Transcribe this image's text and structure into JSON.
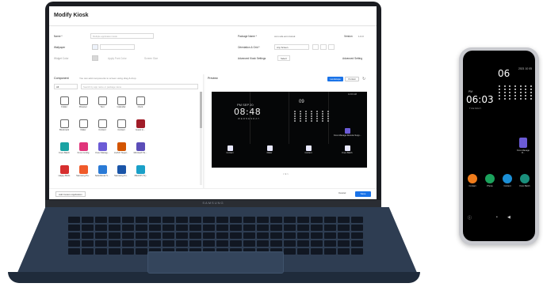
{
  "app": {
    "title": "Modify Kiosk",
    "fields": {
      "name_label": "Name *",
      "name_placeholder": "Multiple application kiosk",
      "package_label": "Package Name *",
      "package_value": "com.sds.emm.kiosk",
      "version_label": "Version",
      "version_value": "1.0.0",
      "wallpaper_label": "Wallpaper",
      "orientation_label": "Orientation & Grid *",
      "orientation_value": "Any Screen",
      "widget_label": "Widget Color",
      "apply_font_label": "Apply Font Color",
      "screen_size_label": "Screen Size",
      "kiosk_settings_label": "Advanced Kiosk Settings",
      "kiosk_settings_button": "Select",
      "advanced_setting": "Advanced Setting"
    },
    "components": {
      "title": "Component",
      "description": "You can add components to screen using drag & drop.",
      "filter": "All",
      "search_placeholder": "Search by app name or package name",
      "tiles": [
        {
          "label": "Folder",
          "icon": "folder-icon"
        },
        {
          "label": "Browser",
          "icon": "browser-icon"
        },
        {
          "label": "Text",
          "icon": "text-icon"
        },
        {
          "label": "Calendar",
          "icon": "calendar-icon"
        },
        {
          "label": "Clock",
          "icon": "clock-icon"
        },
        {
          "label": "Bookmark",
          "icon": "bookmark-icon"
        },
        {
          "label": "Dialer",
          "icon": "phone-icon"
        },
        {
          "label": "Content",
          "icon": "content-icon"
        },
        {
          "label": "Contact",
          "icon": "contact-icon"
        },
        {
          "label": "Guest lo...",
          "icon": "guest-icon"
        },
        {
          "label": "Knox Batch",
          "icon": "app-icon"
        },
        {
          "label": "Knox Config",
          "icon": "app-icon"
        },
        {
          "label": "Knox Manag...",
          "icon": "app-icon"
        },
        {
          "label": "LG/UX Suppl...",
          "icon": "app-icon"
        },
        {
          "label": "Microsoft Te...",
          "icon": "app-icon"
        },
        {
          "label": "Happy Birds",
          "icon": "app-icon"
        },
        {
          "label": "Samsung Pa...",
          "icon": "app-icon"
        },
        {
          "label": "Selectkiosk S...",
          "icon": "app-icon"
        },
        {
          "label": "Samsung Kn...",
          "icon": "app-icon"
        },
        {
          "label": "PEAUP (TL)",
          "icon": "app-icon"
        }
      ]
    },
    "preview": {
      "title": "Preview",
      "landscape": "Landscape",
      "portrait": "Portrait",
      "ampm": "PM",
      "date": "SEP 20",
      "time": "08:48",
      "weekday": "WEDNESDAY",
      "cal_day": "09",
      "status": "12:00 AM",
      "apps": [
        {
          "label": "Contact"
        },
        {
          "label": "Dialer"
        },
        {
          "label": "Content"
        },
        {
          "label": "Knox Batch"
        },
        {
          "label": "Knox Manage Remote Supp..."
        }
      ],
      "pager": "< 1 >"
    },
    "footer": {
      "add_custom": "Add Custom Application",
      "cancel": "Cancel",
      "save": "Save"
    }
  },
  "laptop": {
    "brand": "SAMSUNG"
  },
  "phone": {
    "time_small": "06",
    "date": "2021 10 05",
    "ampm": "PM",
    "time": "06:03",
    "weekday": "TUESDAY",
    "message_label": "Knox Manage R...",
    "apps": [
      {
        "label": "Contact",
        "color": "#f07c1b"
      },
      {
        "label": "Phone",
        "color": "#1ba25c"
      },
      {
        "label": "Content",
        "color": "#1b8fd6"
      },
      {
        "label": "Knox Batch",
        "color": "#1a8f7c"
      }
    ]
  }
}
